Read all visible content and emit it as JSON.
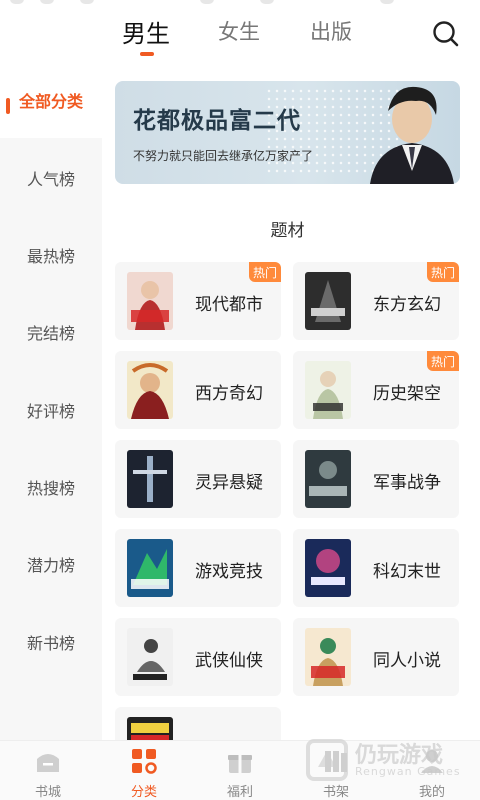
{
  "top_tabs": [
    {
      "label": "男生",
      "active": true
    },
    {
      "label": "女生",
      "active": false
    },
    {
      "label": "出版",
      "active": false
    }
  ],
  "sidebar": {
    "items": [
      {
        "label": "全部分类",
        "active": true
      },
      {
        "label": "人气榜"
      },
      {
        "label": "最热榜"
      },
      {
        "label": "完结榜"
      },
      {
        "label": "好评榜"
      },
      {
        "label": "热搜榜"
      },
      {
        "label": "潜力榜"
      },
      {
        "label": "新书榜"
      }
    ]
  },
  "banner": {
    "title": "花都极品富二代",
    "subtitle": "不努力就只能回去继承亿万家产了"
  },
  "section": {
    "title": "题材"
  },
  "categories": [
    {
      "name": "现代都市",
      "badge": "热门",
      "cover_color": "#b83030"
    },
    {
      "name": "东方玄幻",
      "badge": "热门",
      "cover_color": "#2d2d2d"
    },
    {
      "name": "西方奇幻",
      "badge": "",
      "cover_color": "#c86a2a"
    },
    {
      "name": "历史架空",
      "badge": "热门",
      "cover_color": "#b9c6a4"
    },
    {
      "name": "灵异悬疑",
      "badge": "",
      "cover_color": "#1d2330"
    },
    {
      "name": "军事战争",
      "badge": "",
      "cover_color": "#2f3a3f"
    },
    {
      "name": "游戏竞技",
      "badge": "",
      "cover_color": "#1a5a8a"
    },
    {
      "name": "科幻末世",
      "badge": "",
      "cover_color": "#1a2a5a"
    },
    {
      "name": "武侠仙侠",
      "badge": "",
      "cover_color": "#e8e8e8"
    },
    {
      "name": "同人小说",
      "badge": "",
      "cover_color": "#3a8a5a"
    },
    {
      "name": "",
      "badge": "",
      "cover_color": "#222222"
    }
  ],
  "bottom_nav": [
    {
      "label": "书城",
      "icon": "bookstore-icon"
    },
    {
      "label": "分类",
      "icon": "category-icon",
      "active": true
    },
    {
      "label": "福利",
      "icon": "gift-icon"
    },
    {
      "label": "书架",
      "icon": "bookshelf-icon"
    },
    {
      "label": "我的",
      "icon": "profile-icon"
    }
  ],
  "watermark": {
    "title": "仍玩游戏",
    "subtitle": "Rengwan Games"
  },
  "colors": {
    "accent": "#f05a22",
    "hot_badge": "#ff8a3b"
  }
}
